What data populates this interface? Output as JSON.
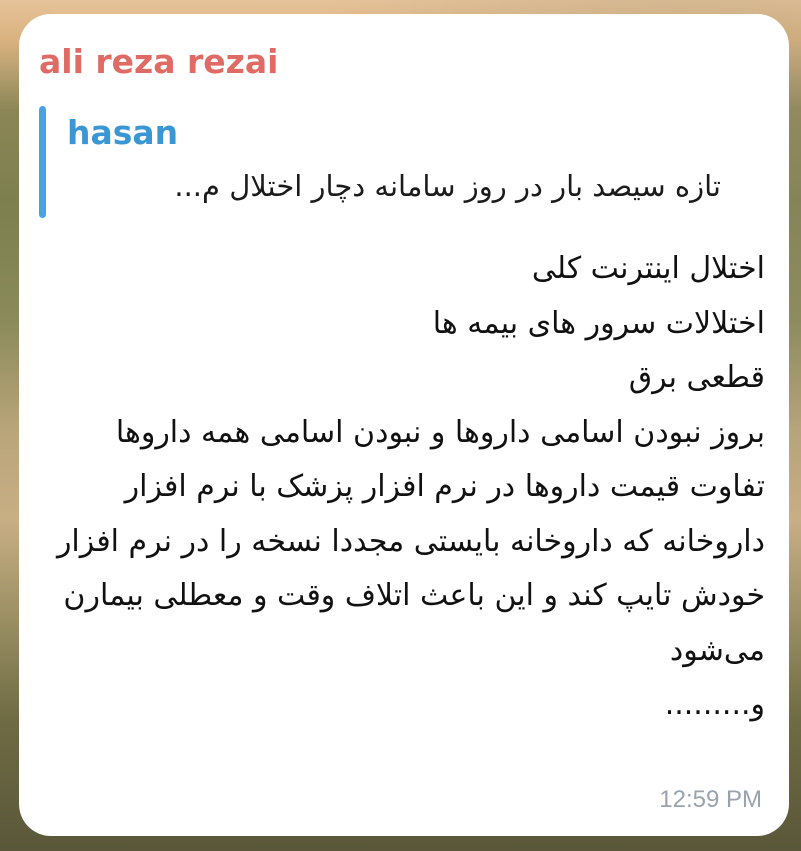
{
  "message": {
    "sender_name": "ali reza rezai",
    "reply": {
      "name": "hasan",
      "text": "تازه سیصد بار در روز سامانه دچار اختلال م..."
    },
    "lines": [
      "اختلال اینترنت کلی",
      "اختلالات سرور های بیمه ها",
      "قطعی برق",
      "بروز نبودن اسامی داروها و نبودن اسامی همه داروها",
      "تفاوت قیمت داروها در نرم افزار پزشک با نرم افزار داروخانه که داروخانه بایستی مجددا نسخه را در نرم افزار خودش تایپ کند و این باعث اتلاف وقت و معطلی بیمارن می‌شود",
      "و........."
    ],
    "time": "12:59 PM"
  },
  "colors": {
    "sender_name": "#e06b65",
    "reply_accent": "#4aa3df",
    "reply_name": "#3a97d4",
    "bubble_background": "#ffffff",
    "time": "#9aa3ad"
  }
}
